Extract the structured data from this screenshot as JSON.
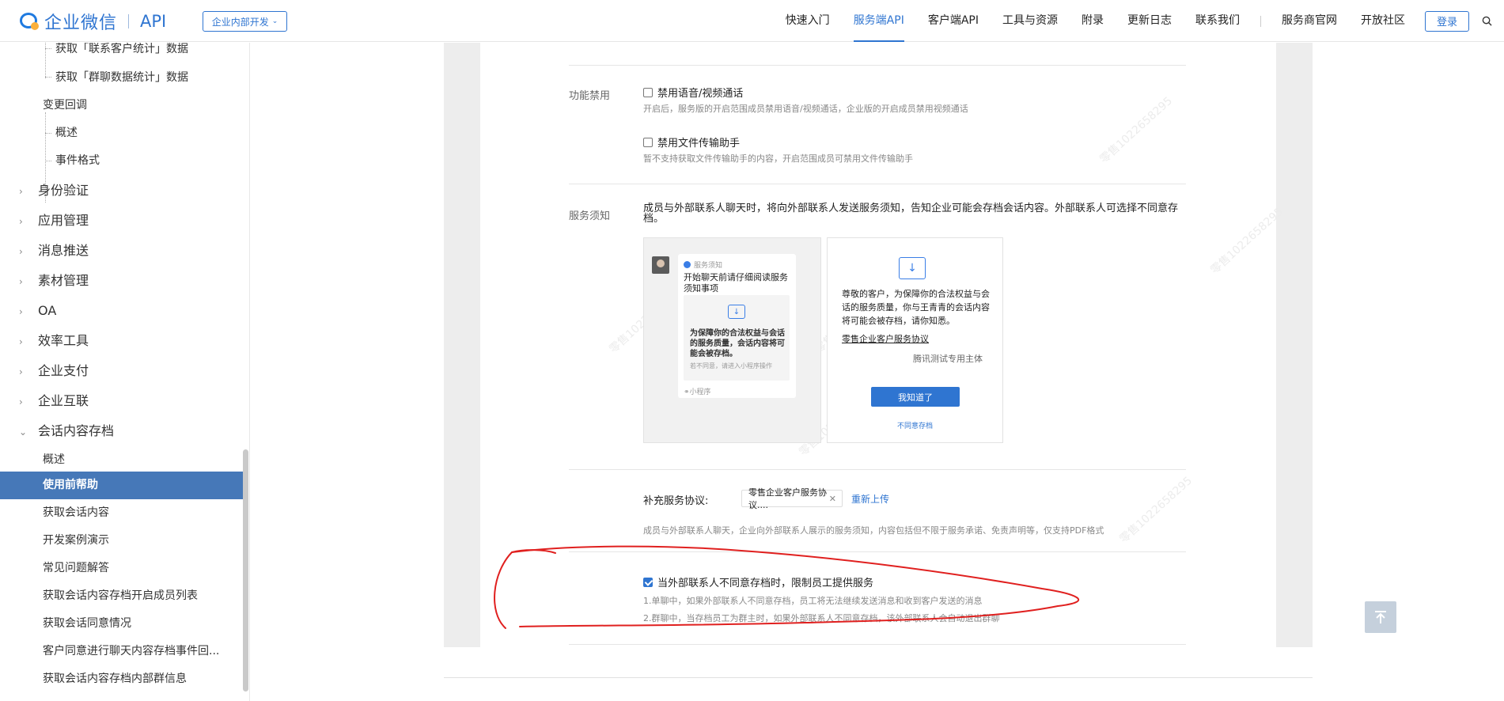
{
  "header": {
    "logo_text": "企业微信",
    "logo_api": "API",
    "dev_select": "企业内部开发",
    "nav": [
      {
        "label": "快速入门",
        "active": false
      },
      {
        "label": "服务端API",
        "active": true
      },
      {
        "label": "客户端API",
        "active": false
      },
      {
        "label": "工具与资源",
        "active": false
      },
      {
        "label": "附录",
        "active": false
      },
      {
        "label": "更新日志",
        "active": false
      },
      {
        "label": "联系我们",
        "active": false
      }
    ],
    "nav_right": [
      "服务商官网",
      "开放社区"
    ],
    "login": "登录"
  },
  "sidebar": {
    "items": [
      {
        "label": "获取「联系客户统计」数据",
        "level": 3
      },
      {
        "label": "获取「群聊数据统计」数据",
        "level": 3
      },
      {
        "label": "变更回调",
        "level": 2
      },
      {
        "label": "概述",
        "level": 3
      },
      {
        "label": "事件格式",
        "level": 3
      },
      {
        "label": "身份验证",
        "level": 1,
        "chevron": "›"
      },
      {
        "label": "应用管理",
        "level": 1,
        "chevron": "›"
      },
      {
        "label": "消息推送",
        "level": 1,
        "chevron": "›"
      },
      {
        "label": "素材管理",
        "level": 1,
        "chevron": "›"
      },
      {
        "label": "OA",
        "level": 1,
        "chevron": "›"
      },
      {
        "label": "效率工具",
        "level": 1,
        "chevron": "›"
      },
      {
        "label": "企业支付",
        "level": 1,
        "chevron": "›"
      },
      {
        "label": "企业互联",
        "level": 1,
        "chevron": "›"
      },
      {
        "label": "会话内容存档",
        "level": 1,
        "chevron": "⌄"
      },
      {
        "label": "概述",
        "level": 2
      },
      {
        "label": "使用前帮助",
        "level": 2,
        "active": true
      },
      {
        "label": "获取会话内容",
        "level": 2
      },
      {
        "label": "开发案例演示",
        "level": 2
      },
      {
        "label": "常见问题解答",
        "level": 2
      },
      {
        "label": "获取会话内容存档开启成员列表",
        "level": 2
      },
      {
        "label": "获取会话同意情况",
        "level": 2
      },
      {
        "label": "客户同意进行聊天内容存档事件回...",
        "level": 2
      },
      {
        "label": "获取会话内容存档内部群信息",
        "level": 2
      }
    ]
  },
  "content": {
    "feature_label": "功能禁用",
    "option1_title": "禁用语音/视频通话",
    "option1_desc": "开启后，服务版的开启范围成员禁用语音/视频通话，企业版的开启成员禁用视频通话",
    "option2_title": "禁用文件传输助手",
    "option2_desc": "暂不支持获取文件传输助手的内容，开启范围成员可禁用文件传输助手",
    "service_label": "服务须知",
    "service_text": "成员与外部联系人聊天时，将向外部联系人发送服务须知，告知企业可能会存档会话内容。外部联系人可选择不同意存档。",
    "card_head": "服务须知",
    "card_title": "开始聊天前请仔细阅读服务须知事项",
    "inner_text": "为保障你的合法权益与会话的服务质量，会话内容将可能会被存档。",
    "inner_note": "若不同意，请进入小程序操作",
    "mini_program": "小程序",
    "b_text": "尊敬的客户，为保障你的合法权益与会话的服务质量，你与王青青的会话内容将可能会被存档，请你知悉。",
    "b_link": "零售企业客户服务协议",
    "b_entity": "腾讯测试专用主体",
    "b_button": "我知道了",
    "b_disagree": "不同意存档",
    "supplement_label": "补充服务协议:",
    "supplement_file": "零售企业客户服务协议....",
    "reupload": "重新上传",
    "supplement_desc": "成员与外部联系人聊天，企业向外部联系人展示的服务须知，内容包括但不限于服务承诺、免责声明等，仅支持PDF格式",
    "restrict_title": "当外部联系人不同意存档时，限制员工提供服务",
    "restrict_desc1": "1.单聊中，如果外部联系人不同意存档，员工将无法继续发送消息和收到客户发送的消息",
    "restrict_desc2": "2.群聊中，当存档员工为群主时，如果外部联系人不同意存档，该外部联系人会自动退出群聊"
  },
  "watermark": "零售1022658295",
  "colors": {
    "brand": "#2f75d1",
    "sidebar_active": "#4678b8",
    "annotation": "#e0201f"
  }
}
